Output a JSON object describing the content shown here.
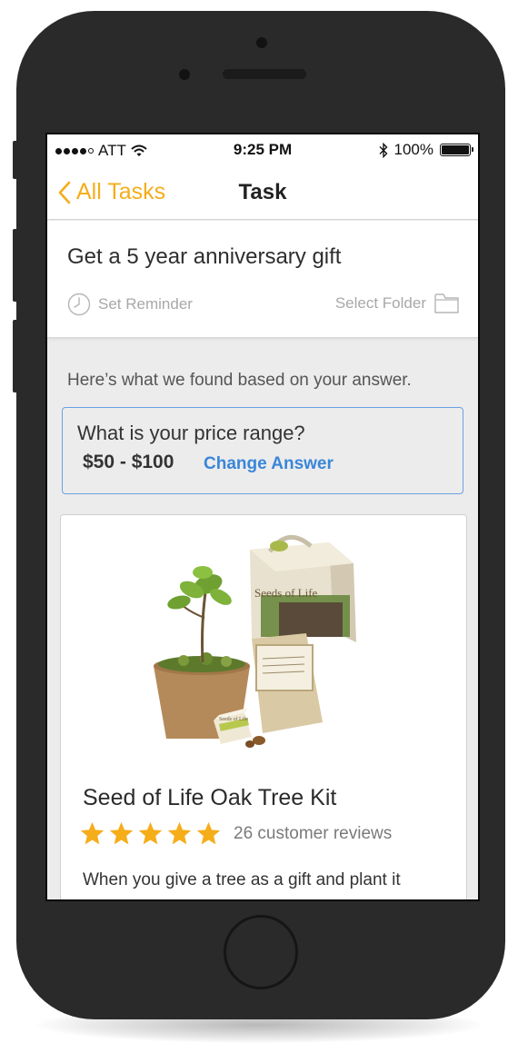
{
  "status_bar": {
    "carrier": "ATT",
    "time": "9:25 PM",
    "battery": "100%",
    "icons": [
      "signal-dots-icon",
      "wifi-icon",
      "bluetooth-icon",
      "battery-icon"
    ]
  },
  "nav": {
    "back_label": "All Tasks",
    "title": "Task"
  },
  "task": {
    "title": "Get a 5 year anniversary gift",
    "reminder_label": "Set Reminder",
    "folder_label": "Select Folder"
  },
  "results": {
    "intro": "Here’s what we found based on your answer."
  },
  "question": {
    "text": "What is your price range?",
    "answer": "$50 - $100",
    "change_label": "Change Answer"
  },
  "product": {
    "name": "Seed of Life Oak Tree Kit",
    "rating": 5,
    "rating_max": 5,
    "reviews": "26 customer reviews",
    "description": "When you give a tree as a gift and plant it",
    "image_box_text": "Seeds of Life",
    "image_label_text": "Seeds of Life"
  },
  "colors": {
    "accent": "#f5ad1a",
    "link": "#3a86d9",
    "answer_border": "#6aa1e3",
    "star": "#f5ad1a",
    "phone_body": "#2a2a2a"
  }
}
